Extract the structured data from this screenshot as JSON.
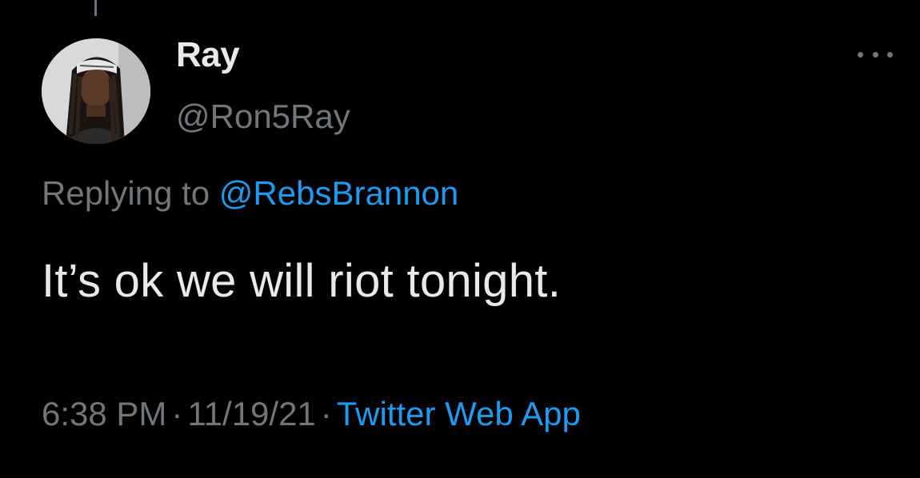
{
  "author": {
    "display_name": "Ray",
    "handle": "@Ron5Ray",
    "avatar_icon": "user-avatar-photo"
  },
  "reply": {
    "prefix": "Replying to ",
    "mention": "@RebsBrannon"
  },
  "tweet": {
    "text": "It’s ok we will riot tonight."
  },
  "meta": {
    "time": "6:38 PM",
    "separator": "·",
    "date": "11/19/21",
    "source": "Twitter Web App"
  },
  "icons": {
    "more": "more-options-icon"
  },
  "colors": {
    "background": "#000000",
    "primary_text": "#e7e9ea",
    "secondary_text": "#71767b",
    "link": "#1d9bf0"
  }
}
